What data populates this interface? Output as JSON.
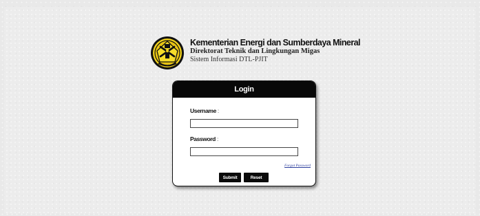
{
  "header": {
    "title": "Kementerian Energi dan Sumberdaya Mineral",
    "subtitle": "Direktorat Teknik dan Lingkungan Migas",
    "system_name": "Sistem Informasi DTL-PJIT",
    "logo_icon": "ministry-emblem-icon",
    "colors": {
      "emblem_gold": "#f2d21b",
      "emblem_dark": "#111111"
    }
  },
  "login": {
    "title": "Login",
    "username_label": "Username",
    "username_value": "",
    "password_label": "Password",
    "password_value": "",
    "separator": ":",
    "forgot_password": "Forgot Password",
    "submit_label": "Submit",
    "reset_label": "Reset",
    "colors": {
      "header_bg": "#080808",
      "button_bg": "#0b0b0b",
      "link": "#2a3c9c"
    }
  }
}
